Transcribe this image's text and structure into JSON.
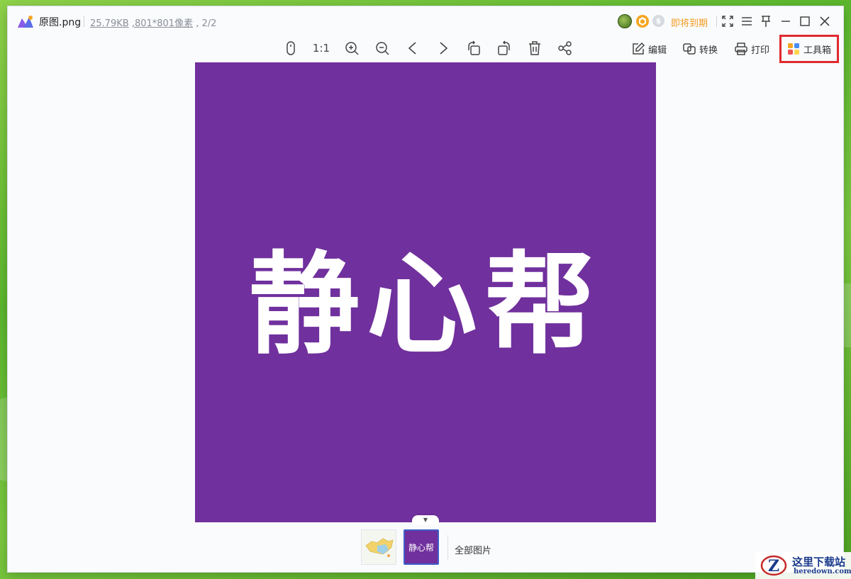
{
  "titlebar": {
    "file_name": "原图.png",
    "file_size": "25.79KB",
    "dimensions": ",801*801像素",
    "page_counter": ", 2/2",
    "expire_label": "即将到期",
    "badge_grey_symbol": "$"
  },
  "toolbar": {
    "actual_size": "1:1",
    "edit_label": "编辑",
    "convert_label": "转换",
    "print_label": "打印",
    "toolbox_label": "工具箱"
  },
  "image": {
    "text": "静心帮",
    "background": "#70309d",
    "text_color": "#ffffff"
  },
  "thumbnails": {
    "active_thumb_text": "静心帮",
    "all_images_label": "全部图片"
  },
  "watermark": {
    "cn": "这里下载站",
    "en": "heredown.com"
  },
  "colors": {
    "accent_orange": "#f39a1e",
    "highlight_red": "#e0292e",
    "selection_blue": "#3f5fc9"
  }
}
